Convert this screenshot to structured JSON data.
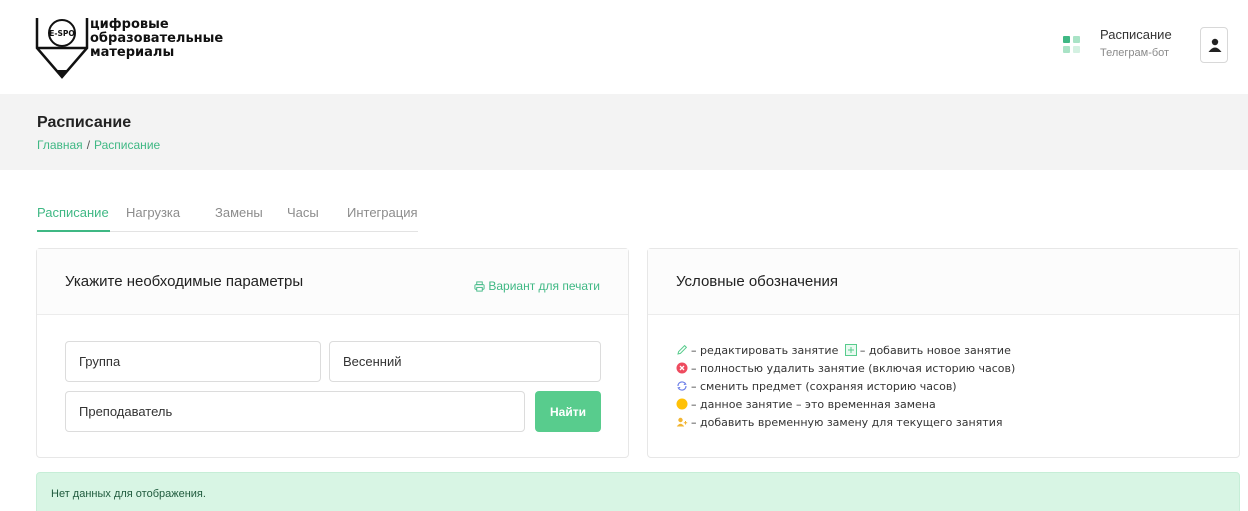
{
  "header": {
    "logo_badge": "E-SPO",
    "logo_lines": [
      "цифровые",
      "образовательные",
      "материалы"
    ],
    "app_title": "Расписание",
    "app_subtitle": "Телеграм-бот",
    "accent_color": "#3fb884"
  },
  "page": {
    "title": "Расписание",
    "breadcrumb": [
      "Главная",
      "Расписание"
    ],
    "breadcrumb_sep": "/"
  },
  "tabs": [
    {
      "label": "Расписание",
      "active": true
    },
    {
      "label": "Нагрузка",
      "active": false
    },
    {
      "label": "Замены",
      "active": false
    },
    {
      "label": "Часы",
      "active": false
    },
    {
      "label": "Интеграция",
      "active": false
    }
  ],
  "params": {
    "title": "Укажите необходимые параметры",
    "print_label": "Вариант для печати",
    "group_value": "Группа",
    "season_value": "Весенний",
    "teacher_value": "Преподаватель",
    "find_label": "Найти"
  },
  "legend": {
    "title": "Условные обозначения",
    "edit": "– редактировать занятие",
    "add": "– добавить новое занятие",
    "delete": "– полностью удалить занятие (включая историю часов)",
    "change": "– сменить предмет (сохраняя историю часов)",
    "temp": "– данное занятие – это временная замена",
    "add_temp": "– добавить временную замену для текущего занятия"
  },
  "alert": {
    "text": "Нет данных для отображения."
  }
}
